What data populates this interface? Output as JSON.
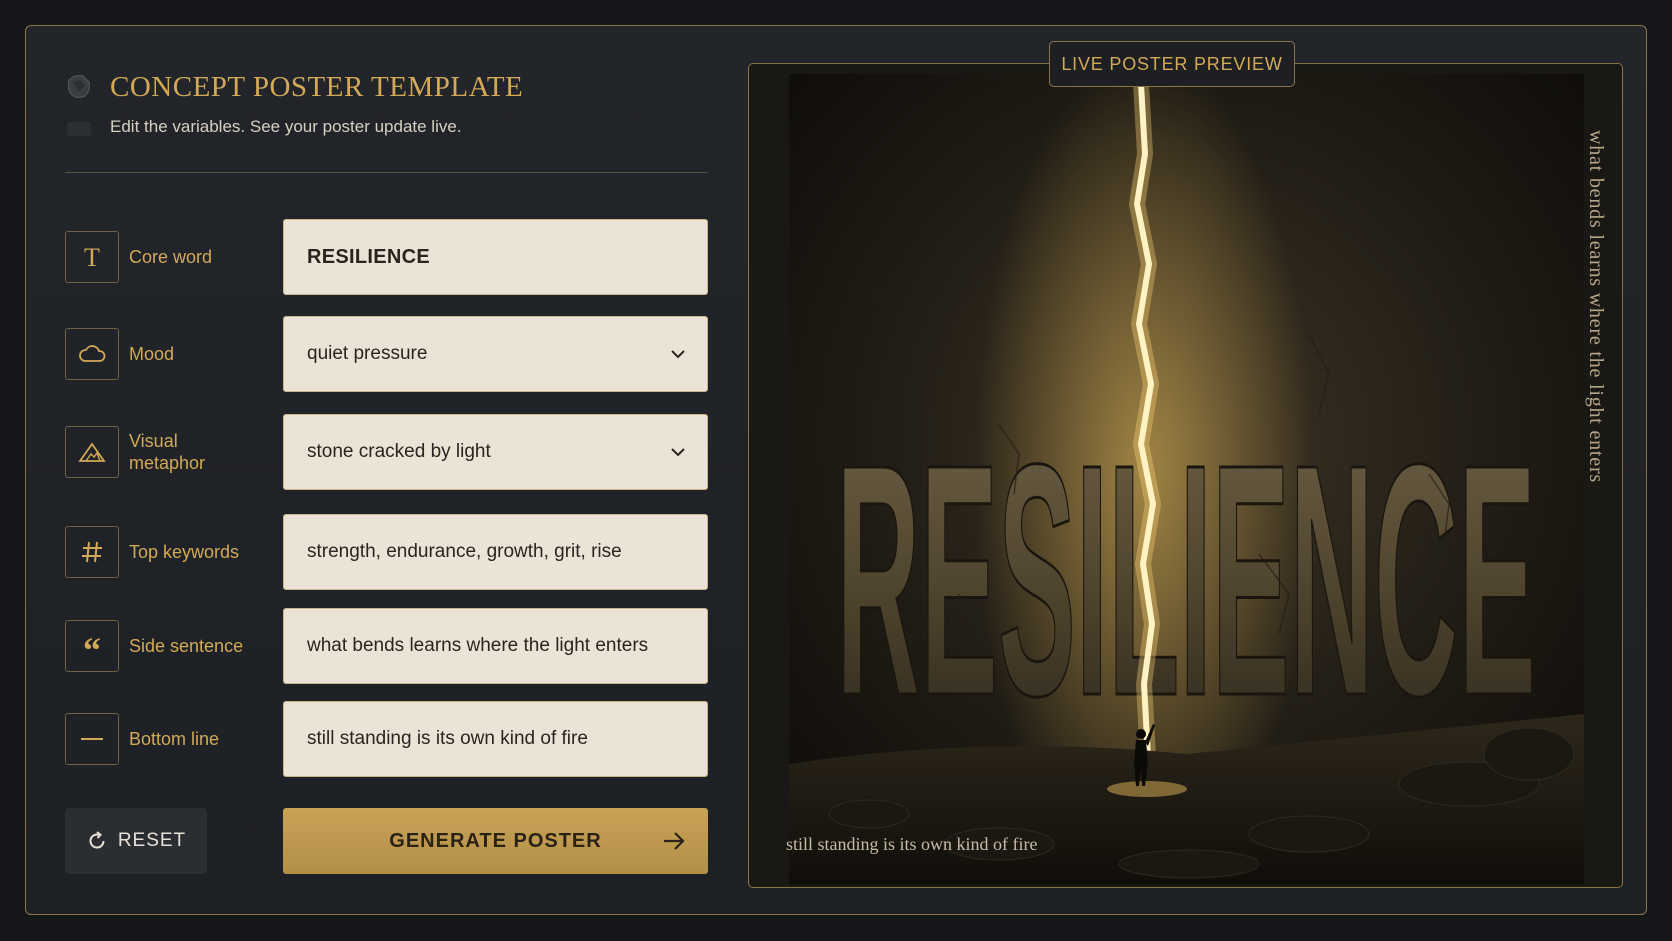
{
  "header": {
    "title": "CONCEPT POSTER TEMPLATE",
    "subtitle": "Edit the variables. See your poster update live."
  },
  "fields": [
    {
      "icon": "text-icon",
      "label": "Core word",
      "value": "RESILIENCE",
      "type": "text"
    },
    {
      "icon": "cloud-icon",
      "label": "Mood",
      "value": "quiet pressure",
      "type": "select"
    },
    {
      "icon": "mountain-icon",
      "label": "Visual metaphor",
      "value": "stone cracked by light",
      "type": "select"
    },
    {
      "icon": "hash-icon",
      "label": "Top keywords",
      "value": "strength, endurance, growth, grit, rise",
      "type": "text"
    },
    {
      "icon": "quote-icon",
      "label": "Side sentence",
      "value": "what bends learns where the light enters",
      "type": "text"
    },
    {
      "icon": "dash-icon",
      "label": "Bottom line",
      "value": "still standing is its own kind of fire",
      "type": "text"
    }
  ],
  "buttons": {
    "reset": "RESET",
    "generate": "GENERATE POSTER"
  },
  "preview": {
    "tab_label": "LIVE POSTER PREVIEW",
    "core_word": "RESILIENCE",
    "side_sentence": "what bends learns where the light enters",
    "bottom_line": "still standing is its own kind of fire"
  },
  "colors": {
    "accent": "#d3a957",
    "background": "#15171b",
    "field_bg": "#ebe3d6",
    "button_gold": "#c8a257"
  }
}
